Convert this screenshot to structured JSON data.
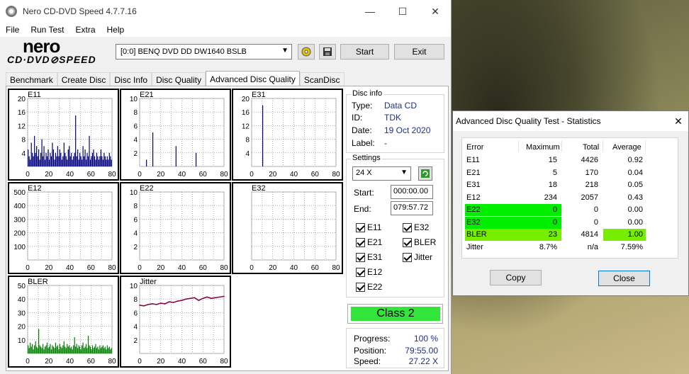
{
  "window": {
    "title": "Nero CD-DVD Speed 4.7.7.16",
    "minimize_glyph": "—",
    "maximize_glyph": "☐",
    "close_glyph": "✕"
  },
  "menu": [
    "File",
    "Run Test",
    "Extra",
    "Help"
  ],
  "logo": {
    "brand": "nero",
    "product": "CD·DVD⊘SPEED"
  },
  "toolbar": {
    "drive": "[0:0]   BENQ DVD DD DW1640 BSLB",
    "start_label": "Start",
    "exit_label": "Exit"
  },
  "tabs": [
    "Benchmark",
    "Create Disc",
    "Disc Info",
    "Disc Quality",
    "Advanced Disc Quality",
    "ScanDisc"
  ],
  "active_tab": "Advanced Disc Quality",
  "disc_info": {
    "title": "Disc info",
    "type_label": "Type:",
    "type": "Data CD",
    "id_label": "ID:",
    "id": "TDK",
    "date_label": "Date:",
    "date": "19 Oct 2020",
    "label_label": "Label:",
    "label": "-"
  },
  "settings": {
    "title": "Settings",
    "speed": "24 X",
    "start_label": "Start:",
    "start": "000:00.00",
    "end_label": "End:",
    "end": "079:57.72",
    "checkboxes": [
      "E11",
      "E32",
      "E21",
      "BLER",
      "E31",
      "Jitter",
      "E12",
      "E22"
    ]
  },
  "class": "Class 2",
  "progress": {
    "progress_label": "Progress:",
    "progress": "100 %",
    "position_label": "Position:",
    "position": "79:55.00",
    "speed_label": "Speed:",
    "speed": "27.22 X"
  },
  "colors": {
    "bar_navy": "#000080",
    "bar_purple": "#800080",
    "bar_green": "#008000",
    "jitter": "#800040",
    "class_green": "#33e43a",
    "stat_green": "#00ee00",
    "stat_lime": "#77ee00"
  },
  "chart_data": [
    {
      "type": "bar",
      "title": "E11",
      "x_ticks": [
        "0",
        "20",
        "40",
        "60",
        "80"
      ],
      "y_ticks": [
        "4",
        "8",
        "12",
        "16",
        "20"
      ],
      "ylim": [
        0,
        20
      ],
      "xlim": [
        0,
        80
      ],
      "color": "#000080",
      "values": [
        5,
        3,
        2,
        7,
        4,
        3,
        9,
        4,
        6,
        3,
        5,
        2,
        4,
        8,
        3,
        6,
        2,
        4,
        3,
        5,
        2,
        4,
        3,
        7,
        5,
        2,
        4,
        3,
        6,
        3,
        5,
        4,
        2,
        3,
        7,
        4,
        3,
        2,
        5,
        6,
        3,
        4,
        2,
        3,
        4,
        15,
        3,
        5,
        2,
        4,
        3,
        2,
        6,
        3,
        5,
        2,
        4,
        3,
        9,
        2,
        3,
        4,
        5,
        3,
        2,
        4,
        3,
        2,
        3,
        5,
        3,
        2,
        4,
        3,
        2,
        3,
        2,
        4,
        3,
        2
      ]
    },
    {
      "type": "bar",
      "title": "E21",
      "x_ticks": [
        "0",
        "20",
        "40",
        "60",
        "80"
      ],
      "y_ticks": [
        "2",
        "4",
        "6",
        "8",
        "10"
      ],
      "ylim": [
        0,
        10
      ],
      "xlim": [
        0,
        80
      ],
      "color": "#000080",
      "values": [
        0,
        0,
        0,
        0,
        0,
        0,
        1,
        0,
        0,
        0,
        0,
        0,
        5,
        0,
        0,
        0,
        0,
        0,
        0,
        0,
        0,
        0,
        0,
        0,
        0,
        0,
        0,
        0,
        0,
        0,
        0,
        0,
        0,
        0,
        3,
        0,
        0,
        0,
        0,
        0,
        0,
        0,
        0,
        0,
        0,
        0,
        0,
        0,
        0,
        0,
        0,
        0,
        0,
        2,
        0,
        0,
        0,
        0,
        0,
        0,
        0,
        0,
        0,
        0,
        0,
        0,
        0,
        0,
        0,
        0,
        0,
        0,
        0,
        0,
        0,
        0,
        0,
        0,
        0,
        0
      ]
    },
    {
      "type": "bar",
      "title": "E31",
      "x_ticks": [
        "0",
        "20",
        "40",
        "60",
        "80"
      ],
      "y_ticks": [
        "4",
        "8",
        "12",
        "16",
        "20"
      ],
      "ylim": [
        0,
        20
      ],
      "xlim": [
        0,
        80
      ],
      "color": "#000080",
      "values": [
        0,
        0,
        0,
        0,
        0,
        0,
        0,
        0,
        0,
        0,
        18,
        0,
        0,
        0,
        0,
        0,
        0,
        0,
        0,
        0,
        0,
        0,
        0,
        0,
        0,
        0,
        0,
        0,
        0,
        0,
        0,
        0,
        0,
        0,
        0,
        0,
        0,
        0,
        0,
        0,
        0,
        0,
        0,
        0,
        0,
        0,
        0,
        0,
        0,
        0,
        0,
        0,
        0,
        0,
        0,
        0,
        0,
        0,
        0,
        0,
        0,
        0,
        0,
        0,
        0,
        0,
        0,
        0,
        0,
        0,
        0,
        0,
        0,
        0,
        0,
        0,
        0,
        0,
        0,
        0
      ]
    },
    {
      "type": "bar",
      "title": "E12",
      "x_ticks": [
        "0",
        "20",
        "40",
        "60",
        "80"
      ],
      "y_ticks": [
        "100",
        "200",
        "300",
        "400",
        "500"
      ],
      "ylim": [
        0,
        500
      ],
      "xlim": [
        0,
        80
      ],
      "color": "#800080",
      "values": [
        0,
        0,
        0,
        0,
        0,
        0,
        0,
        0,
        0,
        0,
        0,
        0,
        0,
        0,
        0,
        0,
        0,
        0,
        0,
        0,
        0,
        0,
        0,
        0,
        0,
        0,
        0,
        0,
        0,
        0,
        0,
        0,
        0,
        0,
        0,
        0,
        0,
        0,
        0,
        0,
        0,
        0,
        0,
        0,
        0,
        0,
        0,
        0,
        0,
        0,
        0,
        0,
        0,
        0,
        0,
        0,
        0,
        0,
        0,
        0,
        0,
        0,
        0,
        0,
        0,
        0,
        0,
        0,
        0,
        0,
        0,
        0,
        0,
        0,
        0,
        0,
        0,
        0,
        0,
        0
      ]
    },
    {
      "type": "bar",
      "title": "E22",
      "x_ticks": [
        "0",
        "20",
        "40",
        "60",
        "80"
      ],
      "y_ticks": [
        "2",
        "4",
        "6",
        "8",
        "10"
      ],
      "ylim": [
        0,
        10
      ],
      "xlim": [
        0,
        80
      ],
      "color": "#000080",
      "values": []
    },
    {
      "type": "bar",
      "title": "E32",
      "x_ticks": [
        "0",
        "20",
        "40",
        "60",
        "80"
      ],
      "y_ticks": [],
      "ylim": [
        0,
        10
      ],
      "xlim": [
        0,
        80
      ],
      "color": "#000080",
      "values": []
    },
    {
      "type": "bar",
      "title": "BLER",
      "x_ticks": [
        "0",
        "20",
        "40",
        "60",
        "80"
      ],
      "y_ticks": [
        "10",
        "20",
        "30",
        "40",
        "50"
      ],
      "ylim": [
        0,
        50
      ],
      "xlim": [
        0,
        80
      ],
      "color": "#008000",
      "values": [
        6,
        4,
        8,
        5,
        7,
        3,
        6,
        9,
        5,
        4,
        18,
        6,
        5,
        4,
        7,
        3,
        5,
        6,
        8,
        4,
        5,
        7,
        3,
        6,
        5,
        4,
        8,
        5,
        6,
        3,
        7,
        5,
        4,
        6,
        9,
        5,
        4,
        7,
        5,
        6,
        4,
        5,
        3,
        6,
        12,
        5,
        7,
        4,
        6,
        5,
        3,
        6,
        8,
        4,
        5,
        7,
        4,
        13,
        6,
        5,
        3,
        6,
        4,
        5,
        7,
        4,
        5,
        3,
        6,
        4,
        5,
        6,
        4,
        5,
        3,
        6,
        4,
        5,
        3,
        4
      ]
    },
    {
      "type": "line",
      "title": "Jitter",
      "x_ticks": [
        "0",
        "20",
        "40",
        "60",
        "80"
      ],
      "y_ticks": [
        "2",
        "4",
        "6",
        "8",
        "10"
      ],
      "ylim": [
        0,
        10
      ],
      "xlim": [
        0,
        80
      ],
      "color": "#800040",
      "x": [
        0,
        4,
        8,
        12,
        16,
        20,
        24,
        28,
        32,
        36,
        40,
        44,
        48,
        52,
        56,
        60,
        64,
        68,
        72,
        76,
        80
      ],
      "values": [
        7.1,
        7.0,
        7.2,
        7.3,
        7.2,
        7.4,
        7.3,
        7.6,
        7.5,
        7.7,
        7.8,
        8.0,
        8.1,
        8.2,
        7.8,
        8.1,
        8.3,
        8.1,
        8.2,
        8.3,
        8.4
      ]
    }
  ],
  "stats_dialog": {
    "title": "Advanced Disc Quality Test - Statistics",
    "headers": [
      "Error",
      "Maximum",
      "Total",
      "Average"
    ],
    "rows": [
      {
        "error": "E11",
        "maximum": "15",
        "total": "4426",
        "average": "0.92",
        "highlight": ""
      },
      {
        "error": "E21",
        "maximum": "5",
        "total": "170",
        "average": "0.04",
        "highlight": ""
      },
      {
        "error": "E31",
        "maximum": "18",
        "total": "218",
        "average": "0.05",
        "highlight": ""
      },
      {
        "error": "E12",
        "maximum": "234",
        "total": "2057",
        "average": "0.43",
        "highlight": ""
      },
      {
        "error": "E22",
        "maximum": "0",
        "total": "0",
        "average": "0.00",
        "highlight": "green"
      },
      {
        "error": "E32",
        "maximum": "0",
        "total": "0",
        "average": "0.00",
        "highlight": "green"
      },
      {
        "error": "BLER",
        "maximum": "23",
        "total": "4814",
        "average": "1.00",
        "highlight": "lime"
      },
      {
        "error": "Jitter",
        "maximum": "8.7%",
        "total": "n/a",
        "average": "7.59%",
        "highlight": ""
      }
    ],
    "copy_label": "Copy",
    "close_label": "Close"
  }
}
